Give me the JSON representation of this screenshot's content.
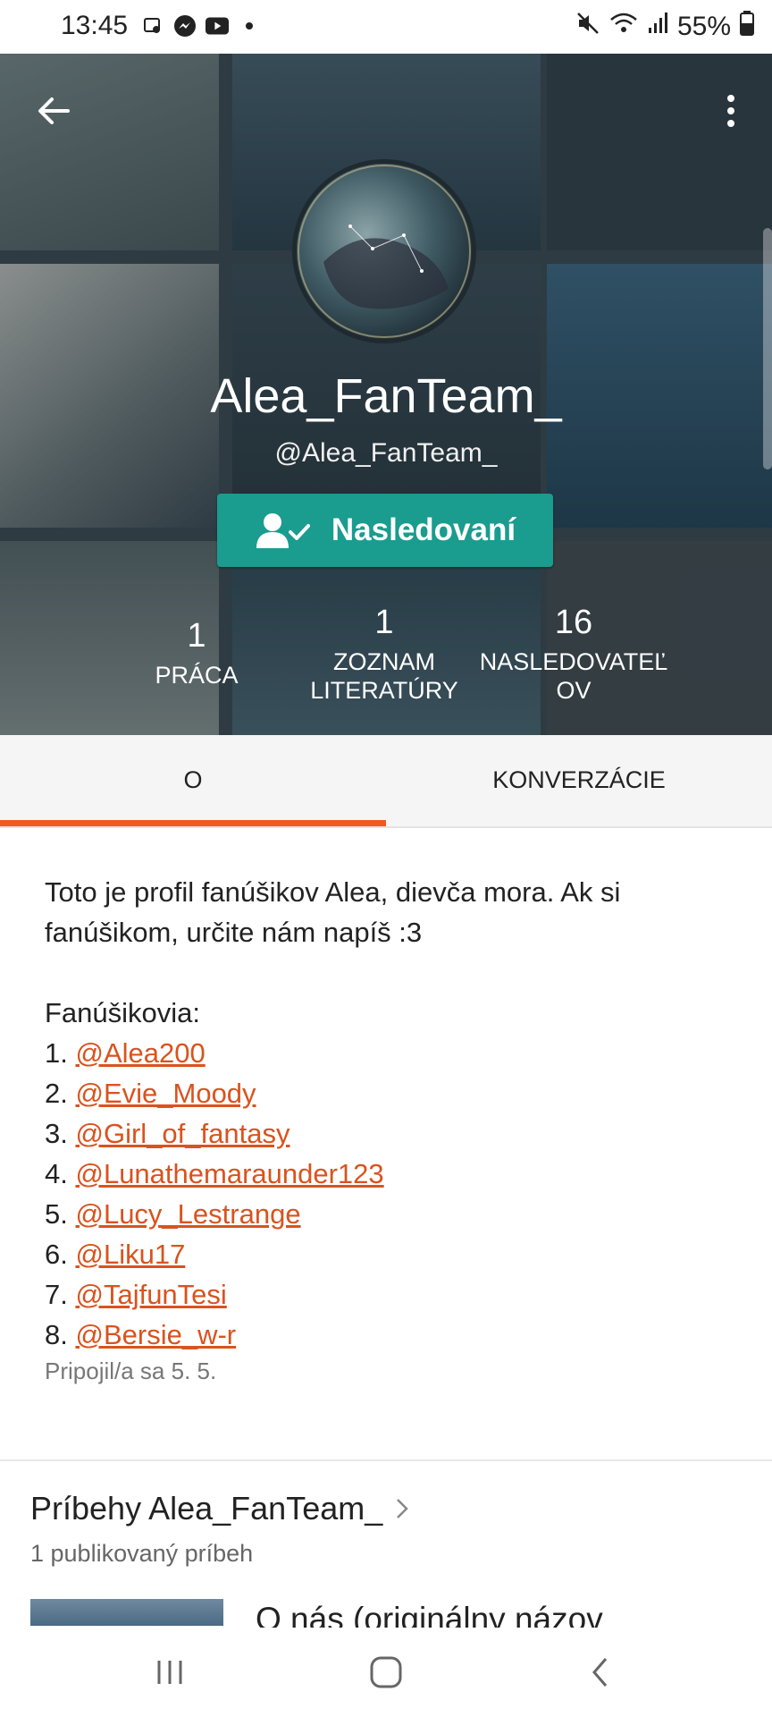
{
  "status_bar": {
    "time": "13:45",
    "battery": "55%",
    "left_icons": [
      "screen-record-icon",
      "messenger-icon",
      "youtube-icon",
      "dot-icon"
    ],
    "right_icons": [
      "mute-icon",
      "wifi-icon",
      "signal-icon",
      "battery-icon"
    ]
  },
  "profile": {
    "display_name": "Alea_FanTeam_",
    "handle": "@Alea_FanTeam_",
    "follow_label": "Nasledovaní",
    "stats": [
      {
        "value": "1",
        "label_line1": "PRÁCA",
        "label_line2": ""
      },
      {
        "value": "1",
        "label_line1": "ZOZNAM",
        "label_line2": "LITERATÚRY"
      },
      {
        "value": "16",
        "label_line1": "NASLEDOVATEĽ",
        "label_line2": "OV"
      }
    ]
  },
  "tabs": [
    {
      "label": "O",
      "active": true
    },
    {
      "label": "KONVERZÁCIE",
      "active": false
    }
  ],
  "about": {
    "intro_line1": "Toto je profil fanúšikov Alea, dievča mora. Ak si",
    "intro_line2": "fanúšikom, určite nám napíš :3",
    "fans_heading": "Fanúšikovia:",
    "fans": [
      {
        "num": "1.",
        "handle": "@Alea200"
      },
      {
        "num": "2.",
        "handle": "@Evie_Moody"
      },
      {
        "num": "3.",
        "handle": "@Girl_of_fantasy"
      },
      {
        "num": "4.",
        "handle": "@Lunathemaraunder123"
      },
      {
        "num": "5.",
        "handle": "@Lucy_Lestrange"
      },
      {
        "num": "6.",
        "handle": "@Liku17"
      },
      {
        "num": "7.",
        "handle": "@TajfunTesi"
      },
      {
        "num": "8.",
        "handle": "@Bersie_w-r"
      }
    ],
    "joined": "Pripojil/a sa 5. 5."
  },
  "stories": {
    "title": "Príbehy Alea_FanTeam_",
    "subtitle": "1 publikovaný príbeh",
    "first_story_title": "O nás (originálny názov"
  },
  "colors": {
    "accent": "#f05a1e",
    "follow": "#1a9c8f",
    "link": "#d9531e"
  }
}
